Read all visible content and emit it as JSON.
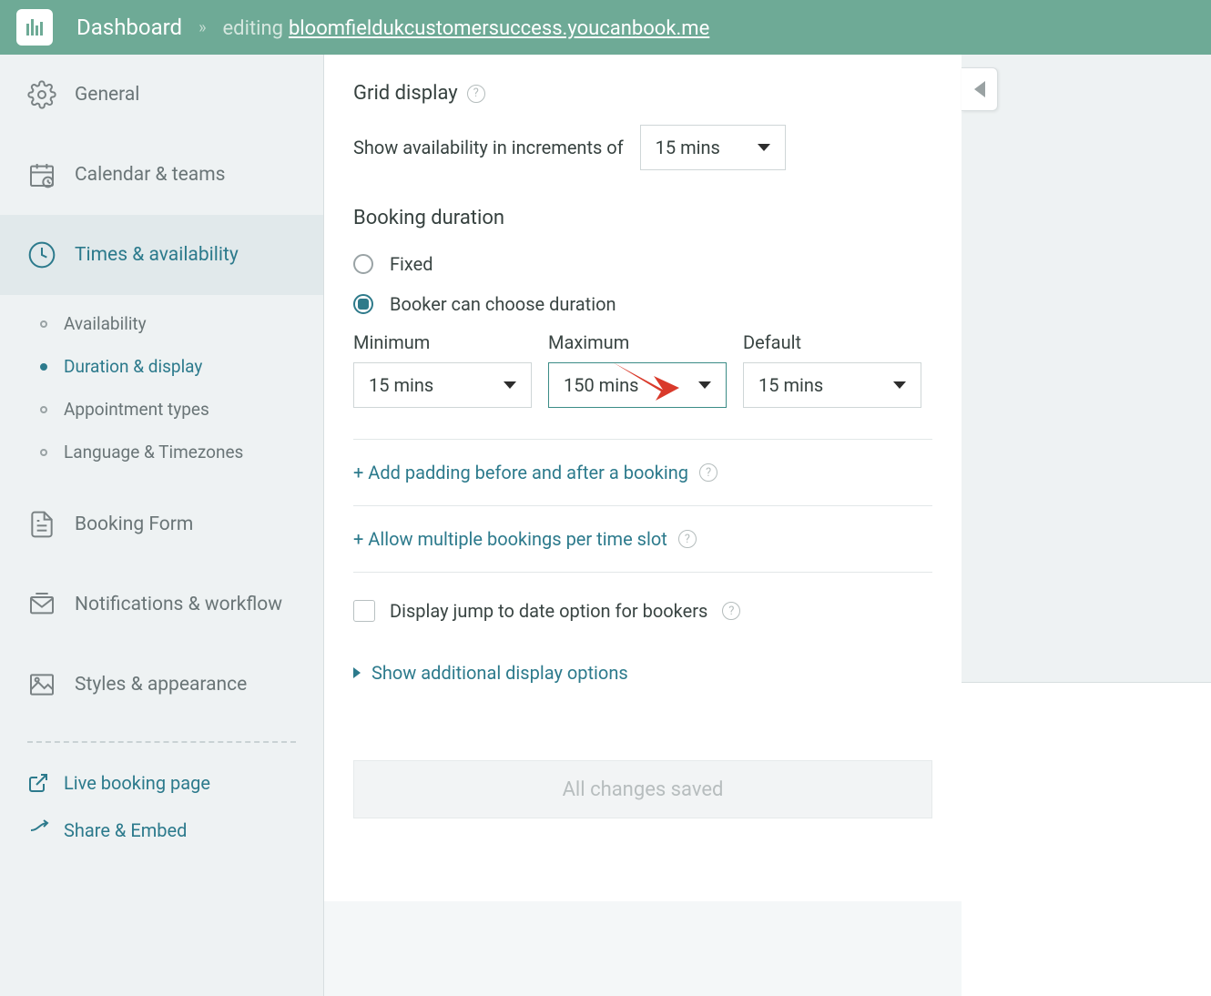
{
  "header": {
    "dashboard": "Dashboard",
    "editing": "editing",
    "url": "bloomfieldukcustomersuccess.youcanbook.me"
  },
  "sidebar": {
    "items": [
      {
        "label": "General"
      },
      {
        "label": "Calendar & teams"
      },
      {
        "label": "Times & availability"
      },
      {
        "label": "Booking Form"
      },
      {
        "label": "Notifications & workflow"
      },
      {
        "label": "Styles & appearance"
      }
    ],
    "sub_items": [
      {
        "label": "Availability"
      },
      {
        "label": "Duration & display"
      },
      {
        "label": "Appointment types"
      },
      {
        "label": "Language & Timezones"
      }
    ],
    "links": {
      "live": "Live booking page",
      "share": "Share & Embed"
    }
  },
  "main": {
    "grid_display": "Grid display",
    "increments_label": "Show availability in increments of",
    "increments_value": "15 mins",
    "booking_duration": "Booking duration",
    "radio_fixed": "Fixed",
    "radio_choose": "Booker can choose duration",
    "columns": {
      "min_label": "Minimum",
      "min_value": "15 mins",
      "max_label": "Maximum",
      "max_value": "150 mins",
      "def_label": "Default",
      "def_value": "15 mins"
    },
    "padding_link": "+ Add padding before and after a booking",
    "multiple_link": "+ Allow multiple bookings per time slot",
    "jump_label": "Display jump to date option for bookers",
    "additional_link": "Show additional display options",
    "save_label": "All changes saved"
  }
}
